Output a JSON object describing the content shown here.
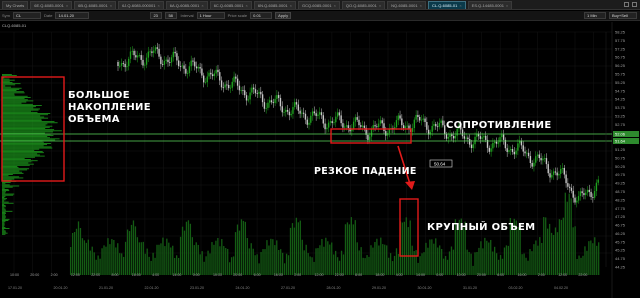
{
  "tabs": [
    {
      "label": "My Charts",
      "active": false
    },
    {
      "label": "6E.Q-6085-0001",
      "active": false
    },
    {
      "label": "6B.Q-6085-0001",
      "active": false
    },
    {
      "label": "6J.Q-6085-000001",
      "active": false
    },
    {
      "label": "6A.Q-6085-0001",
      "active": false
    },
    {
      "label": "6C.Q-6085-0001",
      "active": false
    },
    {
      "label": "6N.Q-6085-0001",
      "active": false
    },
    {
      "label": "GCQ-6085-0001",
      "active": false
    },
    {
      "label": "QO.Q-6085-0001",
      "active": false
    },
    {
      "label": "NQ-6085-0001",
      "active": false
    },
    {
      "label": "CL.Q-6085-01",
      "active": true
    },
    {
      "label": "ES.Q-14485-0001",
      "active": false
    }
  ],
  "toolbar": {
    "symbol_label": "Sym",
    "symbol_value": "CL",
    "date_label": "Date",
    "date_value": "14.01.20",
    "days_value": "23",
    "days2_value": "58",
    "interval_label": "Interval",
    "interval_value": "1 Hour",
    "price_scale_label": "Price scale",
    "price_scale_value": "0.01",
    "apply_label": "Apply",
    "right_dropdown1": "1 Min",
    "right_dropdown2": "Buy+Sell"
  },
  "chart_title": "CLQ-6085-01",
  "price_axis": [
    "58.25",
    "57.75",
    "57.25",
    "56.75",
    "56.25",
    "55.75",
    "55.25",
    "54.75",
    "54.25",
    "53.75",
    "53.25",
    "52.75",
    "52.25",
    "51.75",
    "51.25",
    "50.75",
    "50.25",
    "49.75",
    "49.25",
    "48.75",
    "48.25",
    "47.75",
    "47.25",
    "46.75",
    "46.25",
    "45.75",
    "45.25",
    "44.75",
    "44.25"
  ],
  "price_highlight_1": "52.06",
  "price_highlight_2": "51.64",
  "last_price_tag": "50.64",
  "time_axis_hours": [
    "10:00",
    "20:00",
    "2:00",
    "12:00",
    "22:00",
    "8:00",
    "18:00",
    "4:00",
    "14:00",
    "0:00",
    "10:00",
    "20:00",
    "6:00",
    "16:00",
    "2:00",
    "12:00",
    "22:00",
    "8:00",
    "18:00",
    "4:00",
    "14:00",
    "0:00",
    "10:00",
    "20:00",
    "6:00",
    "16:00",
    "2:00",
    "12:00",
    "22:00"
  ],
  "time_axis_dates": [
    "17.01.20",
    "20.01.20",
    "21.01.20",
    "22.01.20",
    "23.01.20",
    "24.01.20",
    "27.01.20",
    "28.01.20",
    "29.01.20",
    "30.01.20",
    "31.01.20",
    "03.02.20",
    "04.02.20"
  ],
  "annotations": {
    "volume_cluster": "БОЛЬШОЕ\nНАКОПЛЕНИЕ\nОБЪЕМА",
    "resistance": "СОПРОТИВЛЕНИЕ",
    "sharp_drop": "РЕЗКОЕ ПАДЕНИЕ",
    "big_volume": "КРУПНЫЙ ОБЪЕМ"
  },
  "colors": {
    "background": "#000000",
    "candle_up": "#1fa31f",
    "candle_down": "#c8c8c8",
    "volume": "#145c14",
    "annotation_box": "#e11b1b",
    "arrow": "#e11b1b",
    "level_line": "#5ad65a",
    "tab_active": "#0a3a4a"
  }
}
